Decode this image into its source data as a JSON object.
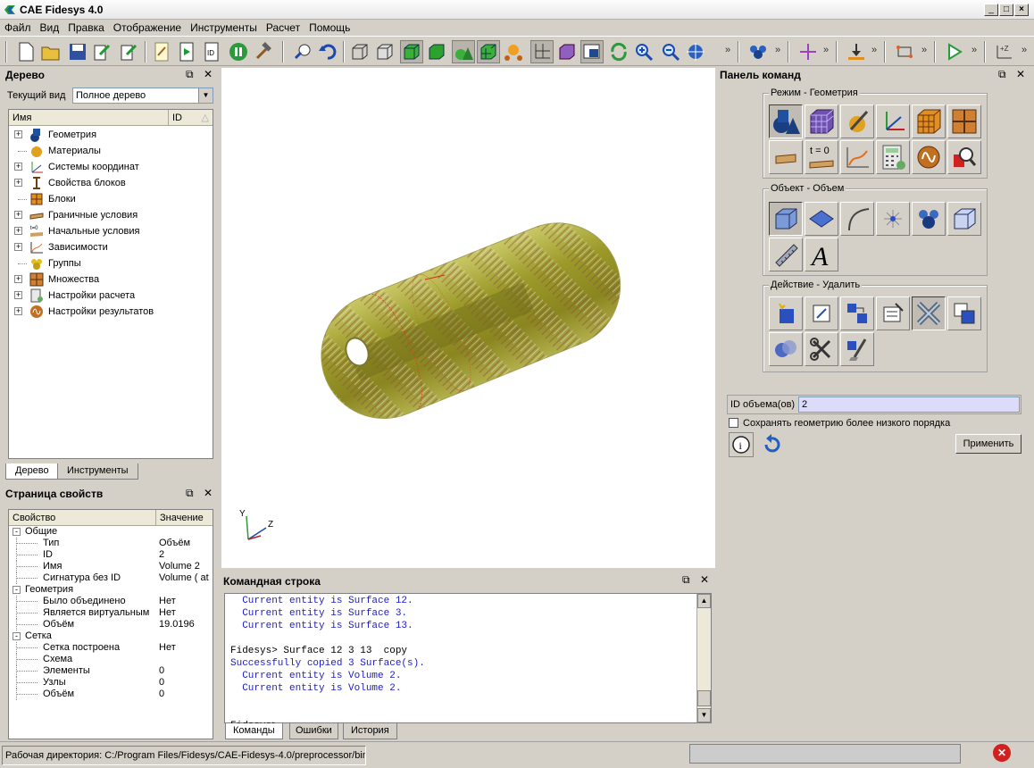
{
  "window": {
    "title": "CAE Fidesys 4.0"
  },
  "menu": [
    "Файл",
    "Вид",
    "Правка",
    "Отображение",
    "Инструменты",
    "Расчет",
    "Помощь"
  ],
  "tree_panel": {
    "title": "Дерево",
    "view_label": "Текущий вид",
    "view_value": "Полное дерево",
    "col_name": "Имя",
    "col_id": "ID",
    "items": [
      {
        "label": "Геометрия",
        "expandable": true
      },
      {
        "label": "Материалы",
        "expandable": false
      },
      {
        "label": "Системы координат",
        "expandable": true
      },
      {
        "label": "Свойства блоков",
        "expandable": true
      },
      {
        "label": "Блоки",
        "expandable": false
      },
      {
        "label": "Граничные условия",
        "expandable": true
      },
      {
        "label": "Начальные условия",
        "expandable": true
      },
      {
        "label": "Зависимости",
        "expandable": true
      },
      {
        "label": "Группы",
        "expandable": false
      },
      {
        "label": "Множества",
        "expandable": true
      },
      {
        "label": "Настройки расчета",
        "expandable": true
      },
      {
        "label": "Настройки результатов",
        "expandable": true
      }
    ],
    "tabs": [
      "Дерево",
      "Инструменты"
    ]
  },
  "props_panel": {
    "title": "Страница свойств",
    "col_prop": "Свойство",
    "col_val": "Значение",
    "rows": [
      {
        "level": 0,
        "label": "Общие",
        "value": "",
        "exp": "-"
      },
      {
        "level": 1,
        "label": "Тип",
        "value": "Объём"
      },
      {
        "level": 1,
        "label": "ID",
        "value": "2"
      },
      {
        "level": 1,
        "label": "Имя",
        "value": "Volume 2"
      },
      {
        "level": 1,
        "label": "Сигнатура без ID",
        "value": "Volume ( at"
      },
      {
        "level": 0,
        "label": "Геометрия",
        "value": "",
        "exp": "-"
      },
      {
        "level": 1,
        "label": "Было объединено",
        "value": "Нет"
      },
      {
        "level": 1,
        "label": "Является виртуальным",
        "value": "Нет"
      },
      {
        "level": 1,
        "label": "Объём",
        "value": "19.0196"
      },
      {
        "level": 0,
        "label": "Сетка",
        "value": "",
        "exp": "-"
      },
      {
        "level": 1,
        "label": "Сетка построена",
        "value": "Нет"
      },
      {
        "level": 1,
        "label": "Схема",
        "value": ""
      },
      {
        "level": 1,
        "label": "Элементы",
        "value": "0"
      },
      {
        "level": 1,
        "label": "Узлы",
        "value": "0"
      },
      {
        "level": 1,
        "label": "Объём",
        "value": "0"
      }
    ]
  },
  "viewport": {
    "axis_y": "Y",
    "axis_z": "Z"
  },
  "cmdline": {
    "title": "Командная строка",
    "lines": [
      {
        "text": "  Current entity is Surface 12.",
        "blue": true
      },
      {
        "text": "  Current entity is Surface 3.",
        "blue": true
      },
      {
        "text": "  Current entity is Surface 13.",
        "blue": true
      },
      {
        "text": "",
        "blue": false
      },
      {
        "text": "Fidesys> Surface 12 3 13  copy",
        "blue": false
      },
      {
        "text": "Successfully copied 3 Surface(s).",
        "blue": true
      },
      {
        "text": "  Current entity is Volume 2.",
        "blue": true
      },
      {
        "text": "  Current entity is Volume 2.",
        "blue": true
      },
      {
        "text": "",
        "blue": false
      },
      {
        "text": "",
        "blue": false
      },
      {
        "text": "Fidesys>",
        "blue": false
      }
    ],
    "tabs": [
      "Команды",
      "Ошибки",
      "История"
    ]
  },
  "command_panel": {
    "title": "Панель команд",
    "group1": "Режим - Геометрия",
    "group2": "Объект - Объем",
    "group3": "Действие - Удалить",
    "t0_label": "t = 0",
    "id_label": "ID объема(ов)",
    "id_value": "2",
    "checkbox_label": "Сохранять геометрию более низкого порядка",
    "apply_label": "Применить"
  },
  "status": {
    "workdir": "Рабочая директория: C:/Program Files/Fidesys/CAE-Fidesys-4.0/preprocessor/bin"
  }
}
